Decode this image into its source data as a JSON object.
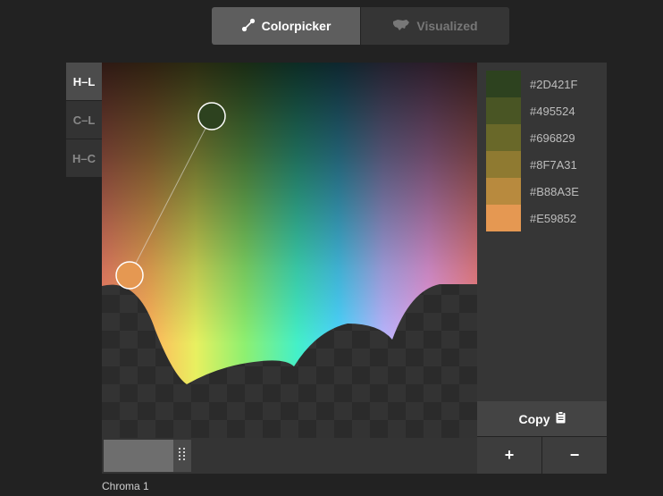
{
  "modes": {
    "colorpicker_label": "Colorpicker",
    "visualized_label": "Visualized",
    "active": "Colorpicker"
  },
  "tabs": [
    {
      "label": "H–L",
      "active": true
    },
    {
      "label": "C–L",
      "active": false
    },
    {
      "label": "H–C",
      "active": false
    }
  ],
  "picker": {
    "start_color": "#2D421F",
    "end_color": "#E59852"
  },
  "palette": [
    {
      "hex": "#2D421F"
    },
    {
      "hex": "#495524"
    },
    {
      "hex": "#696829"
    },
    {
      "hex": "#8F7A31"
    },
    {
      "hex": "#B88A3E"
    },
    {
      "hex": "#E59852"
    }
  ],
  "actions": {
    "copy_label": "Copy",
    "add_label": "+",
    "remove_label": "−"
  },
  "slider": {
    "label": "Chroma 1",
    "value": 0.19
  }
}
